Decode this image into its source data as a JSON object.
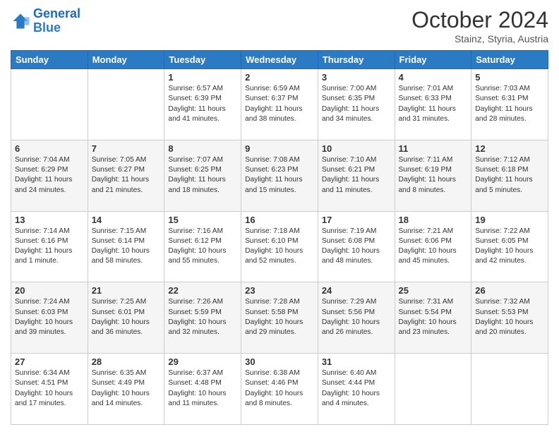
{
  "header": {
    "logo_line1": "General",
    "logo_line2": "Blue",
    "month": "October 2024",
    "location": "Stainz, Styria, Austria"
  },
  "weekdays": [
    "Sunday",
    "Monday",
    "Tuesday",
    "Wednesday",
    "Thursday",
    "Friday",
    "Saturday"
  ],
  "weeks": [
    [
      {
        "day": "",
        "info": ""
      },
      {
        "day": "",
        "info": ""
      },
      {
        "day": "1",
        "info": "Sunrise: 6:57 AM\nSunset: 6:39 PM\nDaylight: 11 hours and 41 minutes."
      },
      {
        "day": "2",
        "info": "Sunrise: 6:59 AM\nSunset: 6:37 PM\nDaylight: 11 hours and 38 minutes."
      },
      {
        "day": "3",
        "info": "Sunrise: 7:00 AM\nSunset: 6:35 PM\nDaylight: 11 hours and 34 minutes."
      },
      {
        "day": "4",
        "info": "Sunrise: 7:01 AM\nSunset: 6:33 PM\nDaylight: 11 hours and 31 minutes."
      },
      {
        "day": "5",
        "info": "Sunrise: 7:03 AM\nSunset: 6:31 PM\nDaylight: 11 hours and 28 minutes."
      }
    ],
    [
      {
        "day": "6",
        "info": "Sunrise: 7:04 AM\nSunset: 6:29 PM\nDaylight: 11 hours and 24 minutes."
      },
      {
        "day": "7",
        "info": "Sunrise: 7:05 AM\nSunset: 6:27 PM\nDaylight: 11 hours and 21 minutes."
      },
      {
        "day": "8",
        "info": "Sunrise: 7:07 AM\nSunset: 6:25 PM\nDaylight: 11 hours and 18 minutes."
      },
      {
        "day": "9",
        "info": "Sunrise: 7:08 AM\nSunset: 6:23 PM\nDaylight: 11 hours and 15 minutes."
      },
      {
        "day": "10",
        "info": "Sunrise: 7:10 AM\nSunset: 6:21 PM\nDaylight: 11 hours and 11 minutes."
      },
      {
        "day": "11",
        "info": "Sunrise: 7:11 AM\nSunset: 6:19 PM\nDaylight: 11 hours and 8 minutes."
      },
      {
        "day": "12",
        "info": "Sunrise: 7:12 AM\nSunset: 6:18 PM\nDaylight: 11 hours and 5 minutes."
      }
    ],
    [
      {
        "day": "13",
        "info": "Sunrise: 7:14 AM\nSunset: 6:16 PM\nDaylight: 11 hours and 1 minute."
      },
      {
        "day": "14",
        "info": "Sunrise: 7:15 AM\nSunset: 6:14 PM\nDaylight: 10 hours and 58 minutes."
      },
      {
        "day": "15",
        "info": "Sunrise: 7:16 AM\nSunset: 6:12 PM\nDaylight: 10 hours and 55 minutes."
      },
      {
        "day": "16",
        "info": "Sunrise: 7:18 AM\nSunset: 6:10 PM\nDaylight: 10 hours and 52 minutes."
      },
      {
        "day": "17",
        "info": "Sunrise: 7:19 AM\nSunset: 6:08 PM\nDaylight: 10 hours and 48 minutes."
      },
      {
        "day": "18",
        "info": "Sunrise: 7:21 AM\nSunset: 6:06 PM\nDaylight: 10 hours and 45 minutes."
      },
      {
        "day": "19",
        "info": "Sunrise: 7:22 AM\nSunset: 6:05 PM\nDaylight: 10 hours and 42 minutes."
      }
    ],
    [
      {
        "day": "20",
        "info": "Sunrise: 7:24 AM\nSunset: 6:03 PM\nDaylight: 10 hours and 39 minutes."
      },
      {
        "day": "21",
        "info": "Sunrise: 7:25 AM\nSunset: 6:01 PM\nDaylight: 10 hours and 36 minutes."
      },
      {
        "day": "22",
        "info": "Sunrise: 7:26 AM\nSunset: 5:59 PM\nDaylight: 10 hours and 32 minutes."
      },
      {
        "day": "23",
        "info": "Sunrise: 7:28 AM\nSunset: 5:58 PM\nDaylight: 10 hours and 29 minutes."
      },
      {
        "day": "24",
        "info": "Sunrise: 7:29 AM\nSunset: 5:56 PM\nDaylight: 10 hours and 26 minutes."
      },
      {
        "day": "25",
        "info": "Sunrise: 7:31 AM\nSunset: 5:54 PM\nDaylight: 10 hours and 23 minutes."
      },
      {
        "day": "26",
        "info": "Sunrise: 7:32 AM\nSunset: 5:53 PM\nDaylight: 10 hours and 20 minutes."
      }
    ],
    [
      {
        "day": "27",
        "info": "Sunrise: 6:34 AM\nSunset: 4:51 PM\nDaylight: 10 hours and 17 minutes."
      },
      {
        "day": "28",
        "info": "Sunrise: 6:35 AM\nSunset: 4:49 PM\nDaylight: 10 hours and 14 minutes."
      },
      {
        "day": "29",
        "info": "Sunrise: 6:37 AM\nSunset: 4:48 PM\nDaylight: 10 hours and 11 minutes."
      },
      {
        "day": "30",
        "info": "Sunrise: 6:38 AM\nSunset: 4:46 PM\nDaylight: 10 hours and 8 minutes."
      },
      {
        "day": "31",
        "info": "Sunrise: 6:40 AM\nSunset: 4:44 PM\nDaylight: 10 hours and 4 minutes."
      },
      {
        "day": "",
        "info": ""
      },
      {
        "day": "",
        "info": ""
      }
    ]
  ]
}
